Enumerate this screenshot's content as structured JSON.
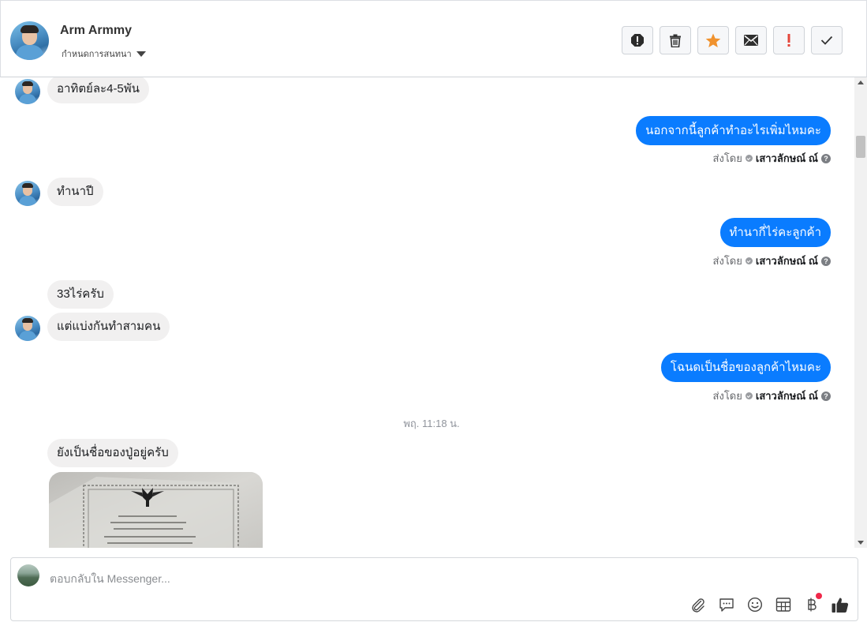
{
  "header": {
    "contact_name": "Arm Armmy",
    "assign_label": "กำหนดการสนทนา",
    "toolbar": [
      {
        "name": "report-icon"
      },
      {
        "name": "trash-icon"
      },
      {
        "name": "star-icon",
        "color": "#f0922e"
      },
      {
        "name": "mail-icon"
      },
      {
        "name": "exclamation-icon",
        "color": "#e4463a"
      },
      {
        "name": "check-icon"
      }
    ]
  },
  "messages": {
    "m1": {
      "text": "อาทิตย์ละ4-5พัน",
      "direction": "in"
    },
    "m2": {
      "text": "นอกจากนี้ลูกค้าทำอะไรเพิ่มไหมคะ",
      "direction": "out"
    },
    "m2_meta": {
      "sent_by_label": "ส่งโดย",
      "agent": "เสาวลักษณ์ ณ์"
    },
    "m3": {
      "text": "ทำนาปี",
      "direction": "in"
    },
    "m4": {
      "text": "ทำนากี่ไร่คะลูกค้า",
      "direction": "out"
    },
    "m4_meta": {
      "sent_by_label": "ส่งโดย",
      "agent": "เสาวลักษณ์ ณ์"
    },
    "m5": {
      "text": "33ไร่ครับ",
      "direction": "in"
    },
    "m6": {
      "text": "แต่แบ่งกันทำสามคน",
      "direction": "in"
    },
    "m7": {
      "text": "โฉนดเป็นชื่อของลูกค้าไหมคะ",
      "direction": "out"
    },
    "m7_meta": {
      "sent_by_label": "ส่งโดย",
      "agent": "เสาวลักษณ์ ณ์"
    },
    "timestamp": "พฤ. 11:18 น.",
    "m8": {
      "text": "ยังเป็นชื่อของปู่อยู่ครับ",
      "direction": "in"
    }
  },
  "composer": {
    "placeholder": "ตอบกลับใน Messenger...",
    "icons": [
      "attachment-icon",
      "chat-bubble-icon",
      "emoji-icon",
      "table-icon",
      "baht-icon",
      "thumbs-up-icon"
    ]
  },
  "colors": {
    "outgoing_bubble": "#0a7cff",
    "incoming_bubble": "#f1f0f0",
    "notification_dot": "#f0284a"
  }
}
